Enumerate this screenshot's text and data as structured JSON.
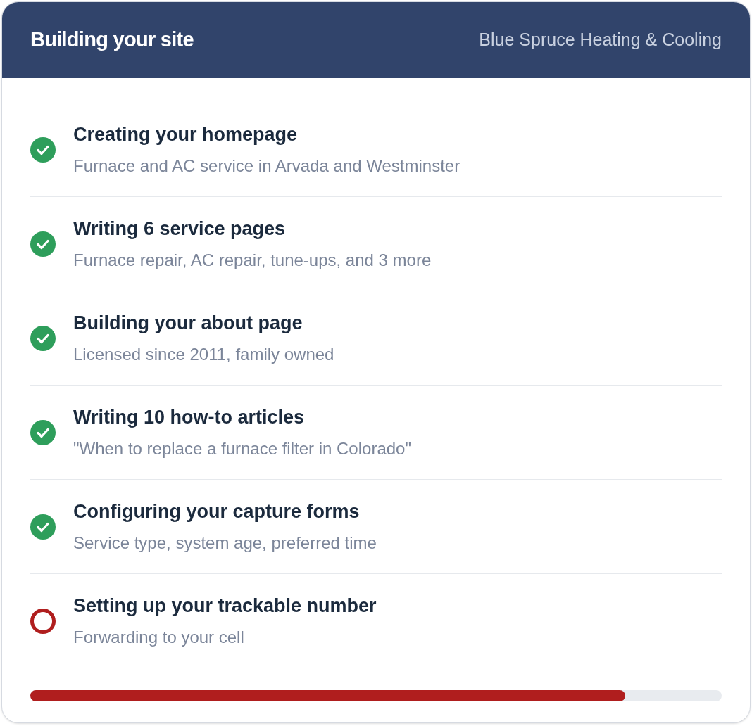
{
  "header": {
    "title": "Building your site",
    "business": "Blue Spruce Heating & Cooling"
  },
  "steps": [
    {
      "title": "Creating your homepage",
      "detail": "Furnace and AC service in Arvada and Westminster",
      "done": true
    },
    {
      "title": "Writing 6 service pages",
      "detail": "Furnace repair, AC repair, tune-ups, and 3 more",
      "done": true
    },
    {
      "title": "Building your about page",
      "detail": "Licensed since 2011, family owned",
      "done": true
    },
    {
      "title": "Writing 10 how-to articles",
      "detail": "\"When to replace a furnace filter in Colorado\"",
      "done": true
    },
    {
      "title": "Configuring your capture forms",
      "detail": "Service type, system age, preferred time",
      "done": true
    },
    {
      "title": "Setting up your trackable number",
      "detail": "Forwarding to your cell",
      "done": false
    }
  ],
  "progress": {
    "level": 0.86
  }
}
